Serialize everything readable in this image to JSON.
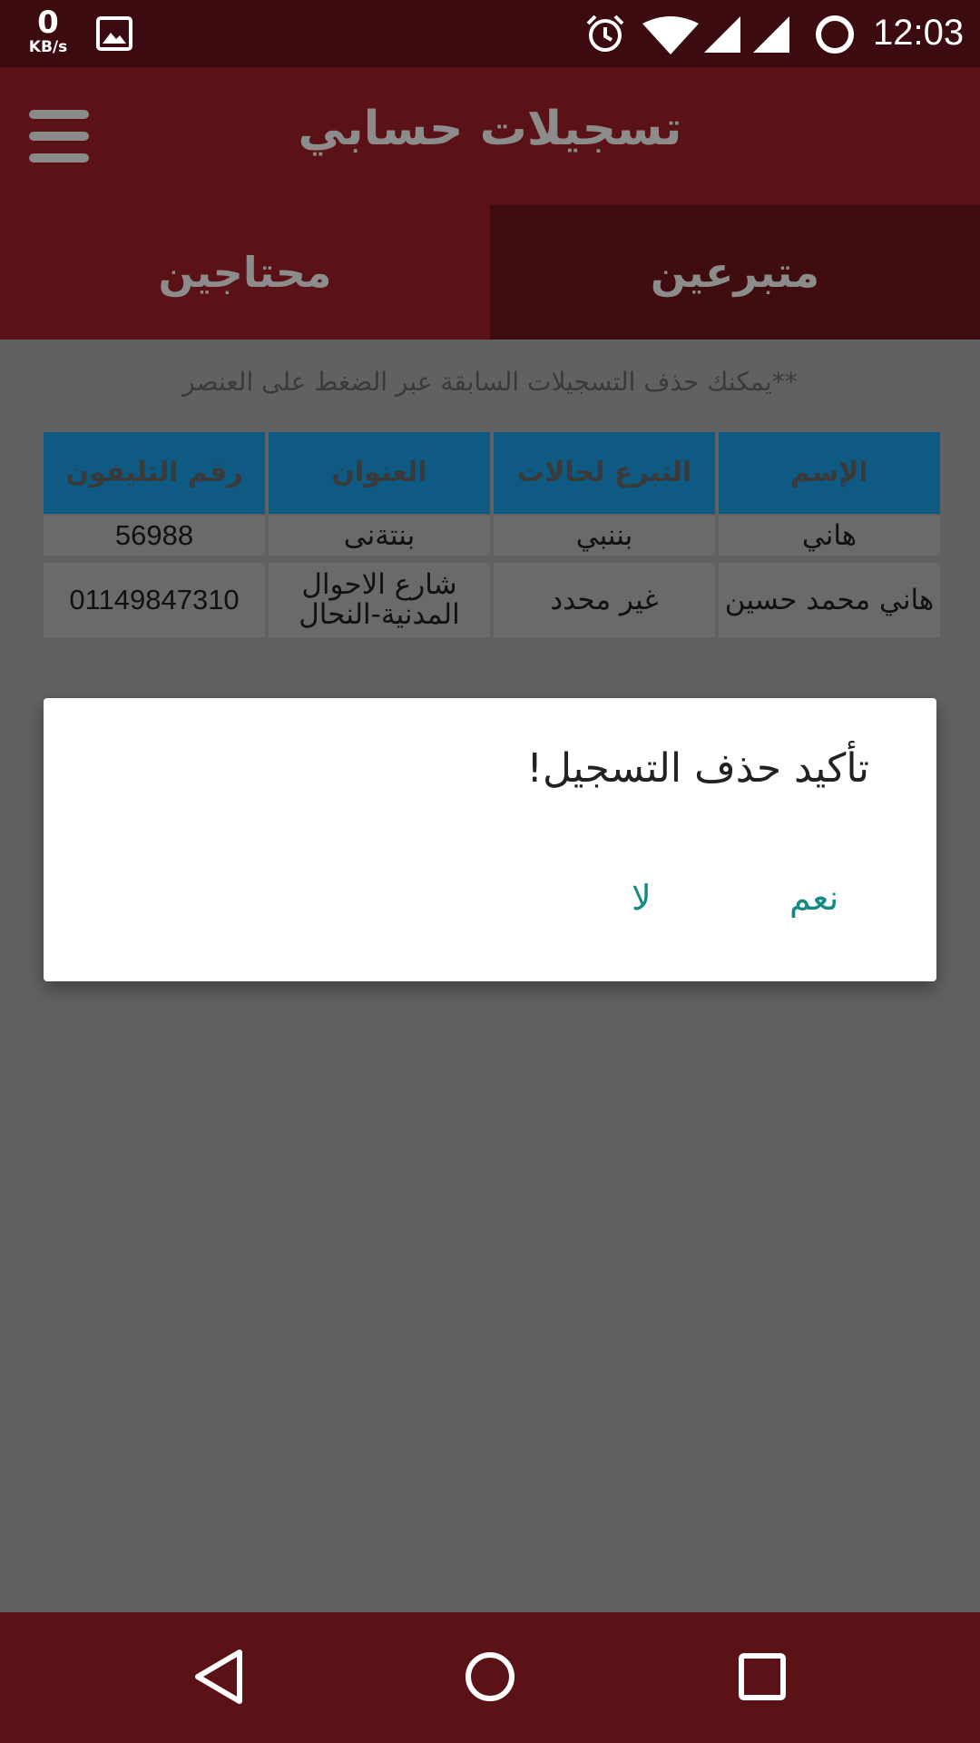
{
  "status_bar": {
    "net_speed_value": "0",
    "net_speed_unit": "KB/s",
    "time": "12:03",
    "icons": [
      "gallery-icon",
      "alarm-icon",
      "wifi-icon",
      "signal-icon",
      "signal-icon",
      "battery-icon"
    ]
  },
  "app_bar": {
    "title": "تسجيلات حسابي",
    "menu_icon": "menu-icon"
  },
  "tabs": [
    {
      "label": "متبرعين",
      "selected": true
    },
    {
      "label": "محتاجين",
      "selected": false
    }
  ],
  "hint": "**يمكنك حذف التسجيلات السابقة عبر الضغط على العنصر",
  "table": {
    "headers": [
      "الإسم",
      "التبرع لحالات",
      "العنوان",
      "رقم التليفون"
    ],
    "rows": [
      [
        "هاني",
        "بننبي",
        "بنتةنى",
        "56988"
      ],
      [
        "هاني محمد حسين",
        "غير محدد",
        "شارع الاحوال المدنية-النحال",
        "01149847310"
      ]
    ]
  },
  "dialog": {
    "message": "تأكيد حذف التسجيل!",
    "yes_label": "نعم",
    "no_label": "لا"
  },
  "nav_bar": {
    "icons": [
      "back-icon",
      "home-icon",
      "recents-icon"
    ]
  },
  "colors": {
    "primary": "#5a1216",
    "tab_selected": "#3f0c10",
    "status_bar": "#3b0b10",
    "table_header": "#0e5a83",
    "dialog_button": "#138a83",
    "scrim_background": "#616161"
  }
}
